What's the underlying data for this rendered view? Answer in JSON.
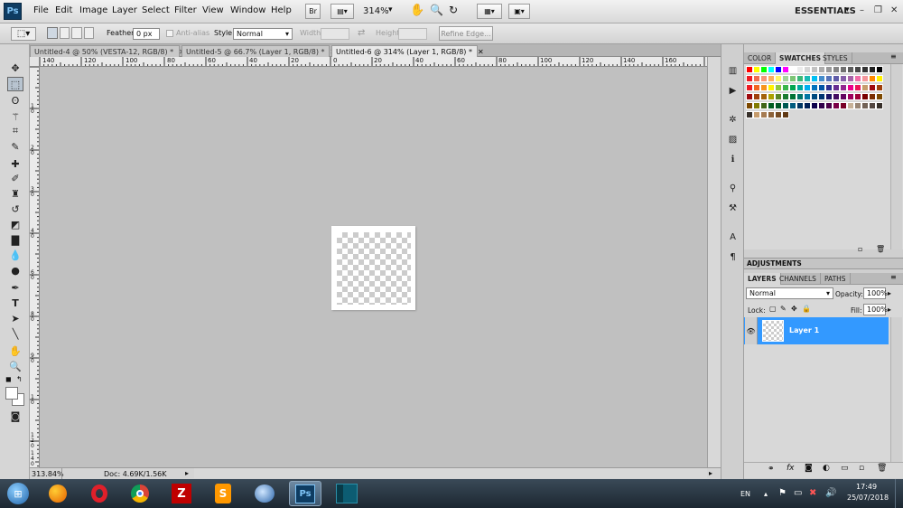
{
  "app": {
    "logo": "Ps"
  },
  "menu": [
    "File",
    "Edit",
    "Image",
    "Layer",
    "Select",
    "Filter",
    "View",
    "Window",
    "Help"
  ],
  "menubar": {
    "bridge_label": "Br",
    "zoom": "314%",
    "workspace": "ESSENTIALS"
  },
  "options": {
    "feather_label": "Feather:",
    "feather_value": "0 px",
    "antialias_label": "Anti-alias",
    "style_label": "Style:",
    "style_value": "Normal",
    "width_label": "Width:",
    "height_label": "Height:",
    "refine_label": "Refine Edge..."
  },
  "doc_tabs": [
    {
      "title": "Untitled-4 @ 50% (VESTA-12, RGB/8) *"
    },
    {
      "title": "Untitled-5 @ 66.7% (Layer 1, RGB/8) *"
    },
    {
      "title": "Untitled-6 @ 314% (Layer 1, RGB/8) *"
    }
  ],
  "ruler_h": [
    "140",
    "120",
    "100",
    "80",
    "60",
    "40",
    "20",
    "0",
    "20",
    "40",
    "60",
    "80",
    "100",
    "120",
    "140",
    "160"
  ],
  "ruler_v": [
    "1",
    "0",
    "2",
    "0",
    "3",
    "0",
    "4",
    "0",
    "6",
    "0",
    "8",
    "0",
    "9",
    "0",
    "1",
    "0",
    "1",
    "2",
    "0",
    "1",
    "4",
    "0"
  ],
  "status": {
    "zoom": "313.84%",
    "doc": "Doc: 4.69K/1.56K"
  },
  "swatches_panel": {
    "tabs": [
      "COLOR",
      "SWATCHES",
      "STYLES"
    ],
    "active": "SWATCHES"
  },
  "adjustments": {
    "title": "ADJUSTMENTS"
  },
  "layers_panel": {
    "tabs": [
      "LAYERS",
      "CHANNELS",
      "PATHS"
    ],
    "active": "LAYERS",
    "blend_mode": "Normal",
    "opacity_label": "Opacity:",
    "opacity_value": "100%",
    "lock_label": "Lock:",
    "fill_label": "Fill:",
    "fill_value": "100%",
    "layers": [
      {
        "name": "Layer 1",
        "visible": true,
        "selected": true
      }
    ]
  },
  "taskbar": {
    "apps": [
      "windows-start",
      "firefox",
      "opera",
      "chrome",
      "filezilla",
      "sublime",
      "thunderbird",
      "photoshop",
      "terminal-app"
    ],
    "active": "photoshop",
    "lang": "EN",
    "time": "17:49",
    "date": "25/07/2018"
  },
  "colors": {
    "accent": "#3399ff",
    "taskbar": "#1c2731",
    "canvas": "#c0c0c0"
  }
}
